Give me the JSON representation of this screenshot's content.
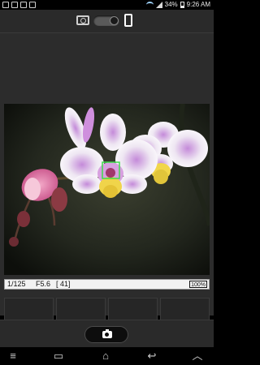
{
  "status_bar": {
    "battery_text": "34%",
    "time": "9:26 AM",
    "icons": [
      "gallery-icon",
      "media-icon",
      "download-icon",
      "photo-icon",
      "wifi-icon",
      "signal-icon",
      "battery-icon"
    ]
  },
  "top_bar": {
    "left_mode": "camera-icon",
    "right_mode": "phone-icon",
    "toggle_state": "phone"
  },
  "info_bar": {
    "shutter": "1/125",
    "aperture": "F5.6",
    "shots": "[ 41]",
    "battery": "100%"
  },
  "thumbnails": [
    "",
    "",
    "",
    ""
  ],
  "bottom_bar": {
    "shutter_icon": "camera-icon"
  },
  "nav_bar": {
    "menu": "≡",
    "recent": "▭",
    "home": "⌂",
    "back": "↩",
    "up": "︿"
  },
  "colors": {
    "panel": "#2a2a2a",
    "background": "#2c2c2c",
    "focus_box": "#3fdc4c"
  }
}
